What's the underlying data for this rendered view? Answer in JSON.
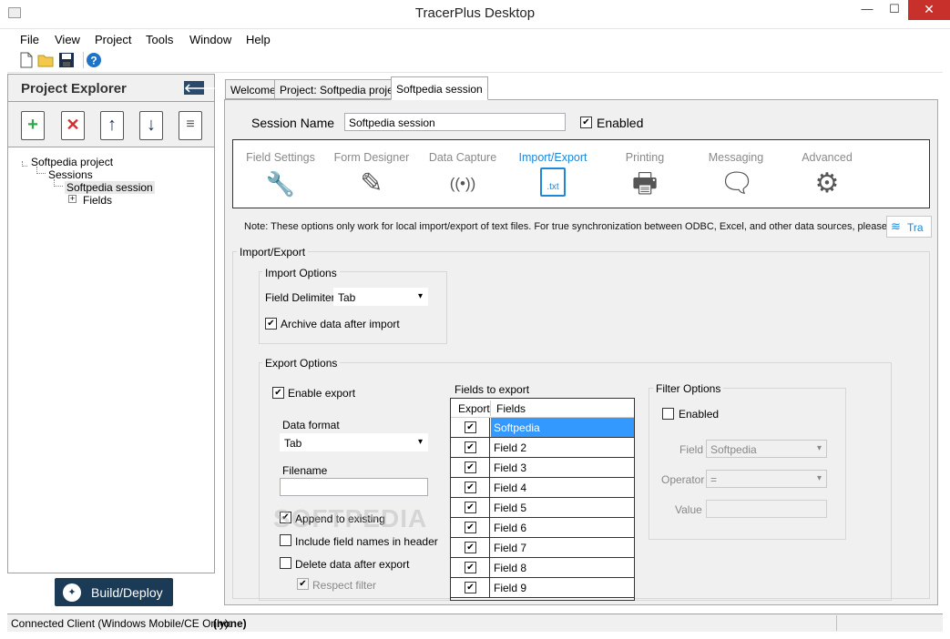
{
  "window": {
    "title": "TracerPlus Desktop",
    "minimize": "—",
    "maximize": "☐",
    "close": "✕"
  },
  "menu": [
    "File",
    "View",
    "Project",
    "Tools",
    "Window",
    "Help"
  ],
  "project_explorer": {
    "title": "Project Explorer",
    "back_icon": "🡐",
    "tree": {
      "project": "Softpedia project",
      "sessions": "Sessions",
      "session": "Softpedia session",
      "fields": "Fields"
    },
    "build_label": "Build/Deploy"
  },
  "tabs": [
    "Welcome",
    "Project: Softpedia project",
    "Softpedia session"
  ],
  "session": {
    "name_label": "Session Name",
    "name_value": "Softpedia session",
    "enabled_label": "Enabled"
  },
  "nav": [
    {
      "label": "Field Settings",
      "icon": "wrench-icon",
      "glyph": "🔧"
    },
    {
      "label": "Form Designer",
      "icon": "pencil-icon",
      "glyph": "✎"
    },
    {
      "label": "Data Capture",
      "icon": "signal-icon",
      "glyph": "((•))"
    },
    {
      "label": "Import/Export",
      "icon": "txt-file-icon",
      "glyph": ".txt"
    },
    {
      "label": "Printing",
      "icon": "printer-icon",
      "glyph": "🖶"
    },
    {
      "label": "Messaging",
      "icon": "speech-bubble-icon",
      "glyph": "🗨"
    },
    {
      "label": "Advanced",
      "icon": "gear-icon",
      "glyph": "⚙"
    }
  ],
  "note": "Note: These options only work for local import/export of text files. For true synchronization between ODBC, Excel, and other data sources, please use",
  "sync_button": "Tra",
  "import_export": {
    "title": "Import/Export",
    "import": {
      "title": "Import Options",
      "field_delimiter_label": "Field Delimiter",
      "field_delimiter_value": "Tab",
      "archive_label": "Archive data after import"
    },
    "export": {
      "title": "Export Options",
      "enable_label": "Enable export",
      "data_format_label": "Data format",
      "data_format_value": "Tab",
      "filename_label": "Filename",
      "filename_value": "",
      "append_label": "Append to existing",
      "include_names_label": "Include field names in header",
      "delete_label": "Delete data after export",
      "respect_filter_label": "Respect filter"
    },
    "fields_to_export": {
      "title": "Fields to export",
      "headers": [
        "Export",
        "Fields"
      ],
      "rows": [
        "Softpedia",
        "Field 2",
        "Field 3",
        "Field 4",
        "Field 5",
        "Field 6",
        "Field 7",
        "Field 8",
        "Field 9"
      ]
    },
    "filter": {
      "title": "Filter Options",
      "enabled_label": "Enabled",
      "field_label": "Field",
      "field_value": "Softpedia",
      "operator_label": "Operator",
      "operator_value": "=",
      "value_label": "Value",
      "value_value": ""
    }
  },
  "status": {
    "label": "Connected Client (Windows Mobile/CE Only):",
    "value": "(none)"
  },
  "watermark": "SOFTPEDIA"
}
